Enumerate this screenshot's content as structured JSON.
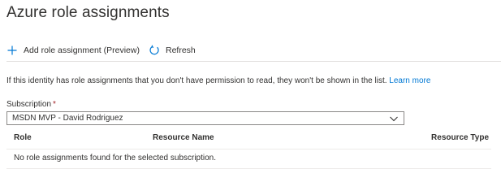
{
  "page": {
    "title": "Azure role assignments"
  },
  "toolbar": {
    "add_label": "Add role assignment (Preview)",
    "refresh_label": "Refresh"
  },
  "info": {
    "message": "If this identity has role assignments that you don't have permission to read, they won't be shown in the list.",
    "link_label": "Learn more"
  },
  "subscription": {
    "label": "Subscription",
    "required_marker": "*",
    "selected": "MSDN MVP - David Rodriguez"
  },
  "table": {
    "columns": [
      "Role",
      "Resource Name",
      "Resource Type"
    ],
    "empty_message": "No role assignments found for the selected subscription."
  },
  "colors": {
    "accent": "#0078d4",
    "required": "#a4262c",
    "text": "#323130",
    "divider": "#e1dfdd"
  },
  "icons": {
    "add": "plus-icon",
    "refresh": "refresh-icon",
    "dropdown": "chevron-down-icon"
  }
}
